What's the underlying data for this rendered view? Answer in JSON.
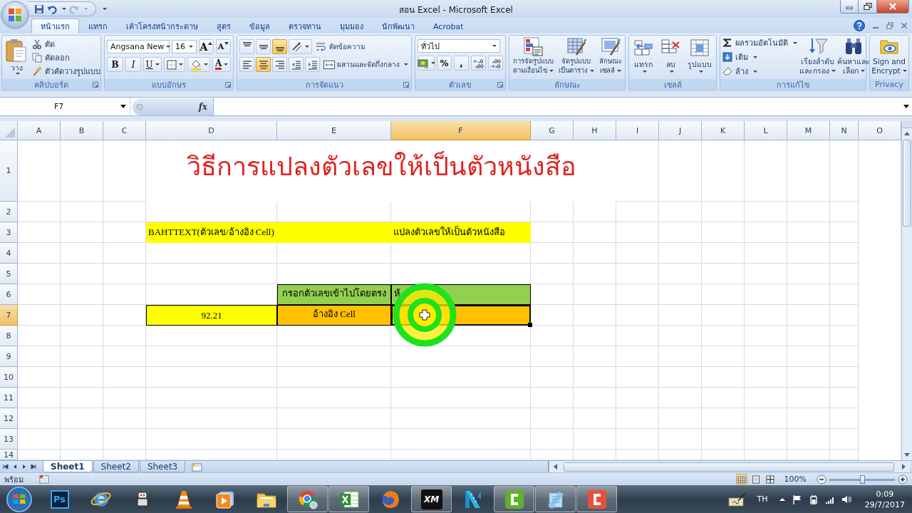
{
  "window": {
    "title": "สอน Excel - Microsoft Excel"
  },
  "ribbon_tabs": [
    {
      "label": "หน้าแรก",
      "selected": true
    },
    {
      "label": "แทรก",
      "selected": false
    },
    {
      "label": "เค้าโครงหน้ากระดาษ",
      "selected": false
    },
    {
      "label": "สูตร",
      "selected": false
    },
    {
      "label": "ข้อมูล",
      "selected": false
    },
    {
      "label": "ตรวจทาน",
      "selected": false
    },
    {
      "label": "มุมมอง",
      "selected": false
    },
    {
      "label": "นักพัฒนา",
      "selected": false
    },
    {
      "label": "Acrobat",
      "selected": false
    }
  ],
  "clipboard": {
    "title": "คลิปบอร์ด",
    "paste": "วาง",
    "cut": "ตัด",
    "copy": "คัดลอก",
    "format_painter": "ตัวคัดวางรูปแบบ"
  },
  "font": {
    "title": "แบบอักษร",
    "font_name": "Angsana New",
    "font_size": "16",
    "grow": "A",
    "shrink": "A",
    "bold": "B",
    "italic": "I",
    "underline": "U",
    "font_color": "A"
  },
  "alignment": {
    "title": "การจัดแนว",
    "vertical": [
      {
        "kind": "top",
        "selected": false
      },
      {
        "kind": "middle",
        "selected": false
      },
      {
        "kind": "bottom",
        "selected": true
      }
    ],
    "horizontal": [
      {
        "kind": "left",
        "selected": false
      },
      {
        "kind": "center",
        "selected": true
      },
      {
        "kind": "right",
        "selected": false
      }
    ],
    "wrap_text": "ตัดข้อความ",
    "merge_center": "ผสานและจัดกึ่งกลาง"
  },
  "number": {
    "title": "ตัวเลข",
    "format": "ทั่วไป",
    "percent": "%",
    "comma": ","
  },
  "styles": {
    "title": "ลักษณะ",
    "buttons": [
      {
        "kind": "conditional",
        "lines": [
          "การจัดรูปแบบ",
          "ตามเงื่อนไข"
        ]
      },
      {
        "kind": "table",
        "lines": [
          "จัดรูปแบบ",
          "เป็นตาราง"
        ]
      },
      {
        "kind": "cell",
        "lines": [
          "ลักษณะ",
          "เซลล์"
        ]
      }
    ]
  },
  "cells": {
    "title": "เซลล์",
    "buttons": [
      {
        "kind": "insert",
        "label": "แทรก"
      },
      {
        "kind": "delete",
        "label": "ลบ"
      },
      {
        "kind": "format",
        "label": "รูปแบบ"
      }
    ]
  },
  "editing": {
    "title": "การแก้ไข",
    "autosum": "ผลรวมอัตโนมัติ",
    "fill": "เติม",
    "clear": "ล้าง",
    "sort_filter": [
      "เรียงลำดับ",
      "และกรอง"
    ],
    "find_select": [
      "ค้นหาและ",
      "เลือก"
    ]
  },
  "privacy": {
    "title": "Privacy",
    "sign_encrypt": [
      "Sign and",
      "Encrypt"
    ]
  },
  "formula_bar": {
    "name_box": "F7",
    "function_button": "fx"
  },
  "sheet": {
    "columns": [
      {
        "label": "A",
        "selected": false
      },
      {
        "label": "B",
        "selected": false
      },
      {
        "label": "C",
        "selected": false
      },
      {
        "label": "D",
        "selected": false
      },
      {
        "label": "E",
        "selected": false
      },
      {
        "label": "F",
        "selected": true
      },
      {
        "label": "G",
        "selected": false
      },
      {
        "label": "H",
        "selected": false
      },
      {
        "label": "I",
        "selected": false
      },
      {
        "label": "J",
        "selected": false
      },
      {
        "label": "K",
        "selected": false
      },
      {
        "label": "L",
        "selected": false
      },
      {
        "label": "M",
        "selected": false
      },
      {
        "label": "N",
        "selected": false
      },
      {
        "label": "O",
        "selected": false
      }
    ],
    "rows": [
      {
        "label": "1",
        "selected": false,
        "cells": [
          {
            "kind": "title",
            "text": "วิธีการแปลงตัวเลขให้เป็นตัวหนังสือ",
            "bordered": false,
            "selected": false
          }
        ]
      },
      {
        "label": "2",
        "selected": false
      },
      {
        "label": "3",
        "selected": false,
        "cells": [
          {
            "kind": "label",
            "text": "BAHTTEXT(ตัวเลข/อ้างอิง Cell)",
            "color": "#ffff00",
            "bordered": false,
            "selected": false
          },
          {
            "kind": "label",
            "text": "แปลงตัวเลขให้เป็นตัวหนังสือ",
            "color": "#ffff00",
            "bordered": false,
            "selected": false
          }
        ]
      },
      {
        "label": "4",
        "selected": false
      },
      {
        "label": "5",
        "selected": false
      },
      {
        "label": "6",
        "selected": false,
        "cells": [
          {
            "kind": "value",
            "text": "กรอกตัวเลขเข้าไปโดยตรง",
            "color": "#92d050",
            "bordered": true,
            "selected": false
          },
          {
            "kind": "label",
            "text": "ห้",
            "color": "#92d050",
            "bordered": true,
            "selected": false
          }
        ]
      },
      {
        "label": "7",
        "selected": true,
        "cells": [
          {
            "kind": "value",
            "text": "92.21",
            "color": "#ffff00",
            "bordered": true,
            "selected": false
          },
          {
            "kind": "value",
            "text": "อ้างอิง Cell",
            "color": "#ffc000",
            "bordered": true,
            "selected": false
          },
          {
            "kind": "value",
            "color": "#ffc000",
            "bordered": true,
            "selected": true
          }
        ]
      },
      {
        "label": "8",
        "selected": false
      },
      {
        "label": "9",
        "selected": false
      },
      {
        "label": "10",
        "selected": false
      },
      {
        "label": "11",
        "selected": false
      },
      {
        "label": "12",
        "selected": false
      },
      {
        "label": "13",
        "selected": false
      },
      {
        "label": "14",
        "selected": false
      }
    ]
  },
  "sheet_tabs": [
    {
      "label": "Sheet1",
      "selected": true
    },
    {
      "label": "Sheet2",
      "selected": false
    },
    {
      "label": "Sheet3",
      "selected": false
    }
  ],
  "status_bar": {
    "status": "พร้อม",
    "views": [
      {
        "kind": "normal",
        "selected": true
      },
      {
        "kind": "page_layout",
        "selected": false
      },
      {
        "kind": "page_break",
        "selected": false
      }
    ],
    "zoom": "100%",
    "zoom_slider": {
      "level": 0.5
    }
  },
  "taskbar": {
    "apps": [
      {
        "kind": "photoshop",
        "label": "Ps",
        "active": false
      },
      {
        "kind": "ie",
        "active": false
      },
      {
        "kind": "robot",
        "active": false
      },
      {
        "kind": "vlc",
        "active": false
      },
      {
        "kind": "player",
        "active": false
      },
      {
        "kind": "folder",
        "active": false
      },
      {
        "kind": "chrome",
        "active": true
      },
      {
        "kind": "excel",
        "active": true
      },
      {
        "kind": "firefox",
        "active": false
      },
      {
        "kind": "xm",
        "label": "XM",
        "active": true
      },
      {
        "kind": "filmora",
        "active": false
      },
      {
        "kind": "camtasia",
        "color": "#5fb12a",
        "active": true
      },
      {
        "kind": "notepad",
        "active": true
      },
      {
        "kind": "camtasia",
        "color": "#e9503a",
        "active": true
      }
    ],
    "language": "TH",
    "time": "0:09",
    "date": "29/7/2017"
  }
}
